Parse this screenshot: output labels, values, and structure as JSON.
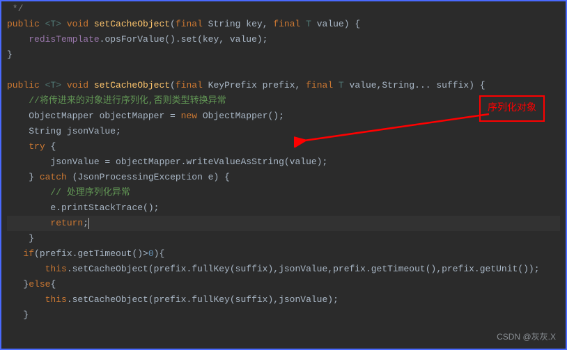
{
  "code": {
    "l0": " */",
    "l1_kw1": "public ",
    "l1_gen": "<T>",
    "l1_kw2": " void ",
    "l1_method": "setCacheObject",
    "l1_p1": "(",
    "l1_kw3": "final ",
    "l1_t1": "String key",
    "l1_c1": ", ",
    "l1_kw4": "final ",
    "l1_t2": "T",
    "l1_t3": " value",
    "l1_p2": ") {",
    "l2_indent": "    ",
    "l2_field": "redisTemplate",
    "l2_call": ".opsForValue().set(key, value);",
    "l3": "}",
    "l4": "",
    "l5_kw1": "public ",
    "l5_gen": "<T>",
    "l5_kw2": " void ",
    "l5_method": "setCacheObject",
    "l5_p1": "(",
    "l5_kw3": "final ",
    "l5_t1": "KeyPrefix prefix",
    "l5_c1": ", ",
    "l5_kw4": "final ",
    "l5_t2": "T",
    "l5_t3": " value",
    "l5_c2": ",String... suffix) {",
    "l6_indent": "    ",
    "l6_comment": "//将传进来的对象进行序列化,否则类型转换异常",
    "l7_indent": "    ",
    "l7_t1": "ObjectMapper objectMapper = ",
    "l7_kw": "new ",
    "l7_t2": "ObjectMapper();",
    "l8_indent": "    ",
    "l8_t1": "String jsonValue;",
    "l9_indent": "    ",
    "l9_kw": "try ",
    "l9_b": "{",
    "l10_indent": "        ",
    "l10_t1": "jsonValue = objectMapper.writeValueAsString(value);",
    "l11_indent": "    ",
    "l11_b1": "} ",
    "l11_kw": "catch ",
    "l11_p": "(JsonProcessingException e) {",
    "l12_indent": "        ",
    "l12_comment": "// 处理序列化异常",
    "l13_indent": "        ",
    "l13_t1": "e.printStackTrace();",
    "l14_indent": "        ",
    "l14_kw": "return",
    "l14_s": ";",
    "l15_indent": "    ",
    "l15_b": "}",
    "l16_indent": "   ",
    "l16_kw": "if",
    "l16_t1": "(prefix.getTimeout()>",
    "l16_num": "0",
    "l16_t2": "){",
    "l17_indent": "       ",
    "l17_kw": "this",
    "l17_t1": ".setCacheObject(prefix.fullKey(suffix),jsonValue,prefix.getTimeout(),prefix.getUnit());",
    "l18_indent": "   ",
    "l18_b1": "}",
    "l18_kw": "else",
    "l18_b2": "{",
    "l19_indent": "       ",
    "l19_kw": "this",
    "l19_t1": ".setCacheObject(prefix.fullKey(suffix),jsonValue);",
    "l20_indent": "   ",
    "l20_b": "}"
  },
  "annotation": {
    "label": "序列化对象"
  },
  "watermark": "CSDN @灰灰.X"
}
